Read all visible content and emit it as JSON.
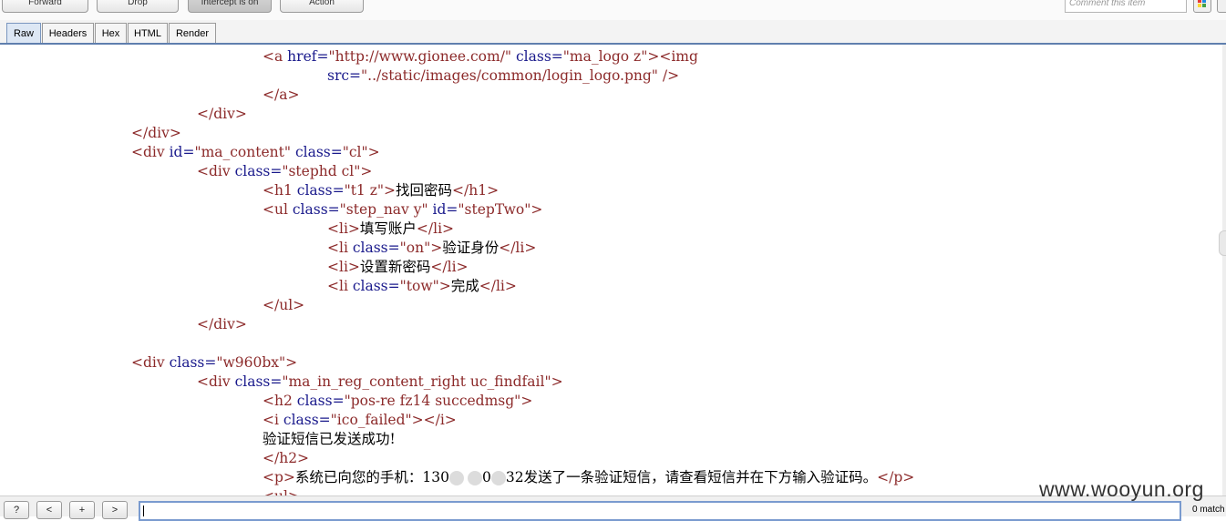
{
  "toolbar": {
    "forward": "Forward",
    "drop": "Drop",
    "intercept": "Intercept is on",
    "action": "Action",
    "comment_placeholder": "Comment this item"
  },
  "tabs": [
    "Raw",
    "Headers",
    "Hex",
    "HTML",
    "Render"
  ],
  "code": {
    "l1": {
      "href_val": "\"http://www.gionee.com/\"",
      "class_val": "\"ma_logo z\""
    },
    "l2": {
      "src_val": "\"../static/images/common/login_logo.png\""
    },
    "l6": {
      "id_val": "\"ma_content\"",
      "class_val": "\"cl\""
    },
    "l7": {
      "class_val": "\"stephd cl\""
    },
    "l8": {
      "class_val": "\"t1 z\"",
      "text": "找回密码"
    },
    "l9": {
      "class_val": "\"step_nav y\"",
      "id_val": "\"stepTwo\""
    },
    "l10": {
      "text": "填写账户"
    },
    "l11": {
      "class_val": "\"on\"",
      "text": "验证身份"
    },
    "l12": {
      "text": "设置新密码"
    },
    "l13": {
      "class_val": "\"tow\"",
      "text": "完成"
    },
    "l17": {
      "class_val": "\"w960bx\""
    },
    "l18": {
      "class_val": "\"ma_in_reg_content_right uc_findfail\""
    },
    "l19": {
      "class_val": "\"pos-re fz14 succedmsg\""
    },
    "l20": {
      "class_val": "\"ico_failed\""
    },
    "l21": {
      "text": "验证短信已发送成功!"
    },
    "l23": {
      "text_a": "系统已向您的手机：130",
      "text_b": "0",
      "text_c": "32发送了一条验证短信，请查看短信并在下方输入验证码。"
    }
  },
  "bottom": {
    "help": "?",
    "prev": "<",
    "add": "+",
    "next": ">",
    "matches": "0 match"
  },
  "watermark": "www.wooyun.org"
}
